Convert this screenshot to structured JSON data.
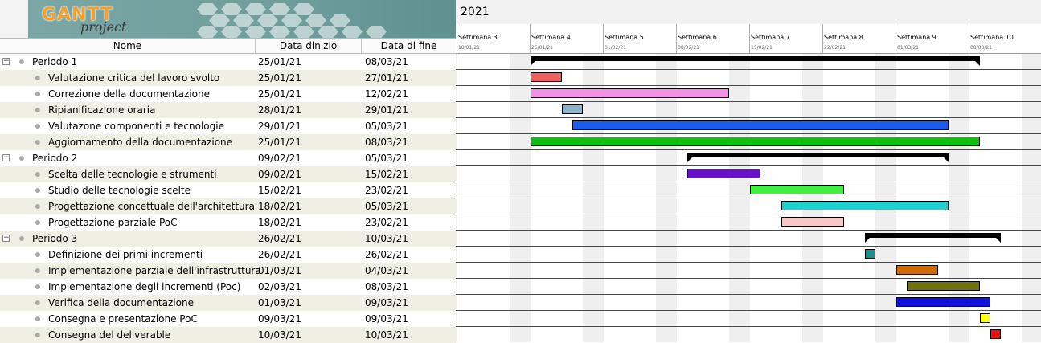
{
  "app": {
    "logo_main": "GANTT",
    "logo_sub": "project"
  },
  "table": {
    "headers": {
      "name": "Nome",
      "start": "Data dinizio",
      "end": "Data di fine"
    },
    "rows": [
      {
        "name": "Periodo 1",
        "start": "25/01/21",
        "end": "08/03/21",
        "group": true
      },
      {
        "name": "Valutazione critica del lavoro svolto",
        "start": "25/01/21",
        "end": "27/01/21",
        "group": false
      },
      {
        "name": "Correzione della documentazione",
        "start": "25/01/21",
        "end": "12/02/21",
        "group": false
      },
      {
        "name": "Ripianificazione oraria",
        "start": "28/01/21",
        "end": "29/01/21",
        "group": false
      },
      {
        "name": "Valutazone componenti e tecnologie",
        "start": "29/01/21",
        "end": "05/03/21",
        "group": false
      },
      {
        "name": "Aggiornamento della documentazione",
        "start": "25/01/21",
        "end": "08/03/21",
        "group": false
      },
      {
        "name": "Periodo 2",
        "start": "09/02/21",
        "end": "05/03/21",
        "group": true
      },
      {
        "name": "Scelta delle tecnologie e strumenti",
        "start": "09/02/21",
        "end": "15/02/21",
        "group": false
      },
      {
        "name": "Studio delle tecnologie scelte",
        "start": "15/02/21",
        "end": "23/02/21",
        "group": false
      },
      {
        "name": "Progettazione concettuale dell'architettura",
        "start": "18/02/21",
        "end": "05/03/21",
        "group": false
      },
      {
        "name": "Progettazione parziale PoC",
        "start": "18/02/21",
        "end": "23/02/21",
        "group": false
      },
      {
        "name": "Periodo 3",
        "start": "26/02/21",
        "end": "10/03/21",
        "group": true
      },
      {
        "name": "Definizione dei primi incrementi",
        "start": "26/02/21",
        "end": "26/02/21",
        "group": false
      },
      {
        "name": "Implementazione parziale dell'infrastruttura",
        "start": "01/03/21",
        "end": "04/03/21",
        "group": false
      },
      {
        "name": "Implementazione degli incrementi (Poc)",
        "start": "02/03/21",
        "end": "08/03/21",
        "group": false
      },
      {
        "name": "Verifica della documentazione",
        "start": "01/03/21",
        "end": "09/03/21",
        "group": false
      },
      {
        "name": "Consegna e presentazione PoC",
        "start": "09/03/21",
        "end": "09/03/21",
        "group": false
      },
      {
        "name": "Consegna del deliverable",
        "start": "10/03/21",
        "end": "10/03/21",
        "group": false
      }
    ]
  },
  "timeline": {
    "year": "2021",
    "weeks": [
      {
        "label": "Settimana 3",
        "date": "18/01/21"
      },
      {
        "label": "Settimana 4",
        "date": "25/01/21"
      },
      {
        "label": "Settimana 5",
        "date": "01/02/21"
      },
      {
        "label": "Settimana 6",
        "date": "08/02/21"
      },
      {
        "label": "Settimana 7",
        "date": "15/02/21"
      },
      {
        "label": "Settimana 8",
        "date": "22/02/21"
      },
      {
        "label": "Settimana 9",
        "date": "01/03/21"
      },
      {
        "label": "Settimana 10",
        "date": "08/03/21"
      }
    ]
  },
  "colors": {
    "bars": [
      "#000000",
      "#f06060",
      "#f590e8",
      "#8fb2cc",
      "#1a5cf0",
      "#10c010",
      "#000000",
      "#6a10c8",
      "#40f040",
      "#20d0d0",
      "#f8c8c8",
      "#000000",
      "#1a9090",
      "#d06a00",
      "#707010",
      "#1010e0",
      "#ffff00",
      "#f01010"
    ]
  }
}
